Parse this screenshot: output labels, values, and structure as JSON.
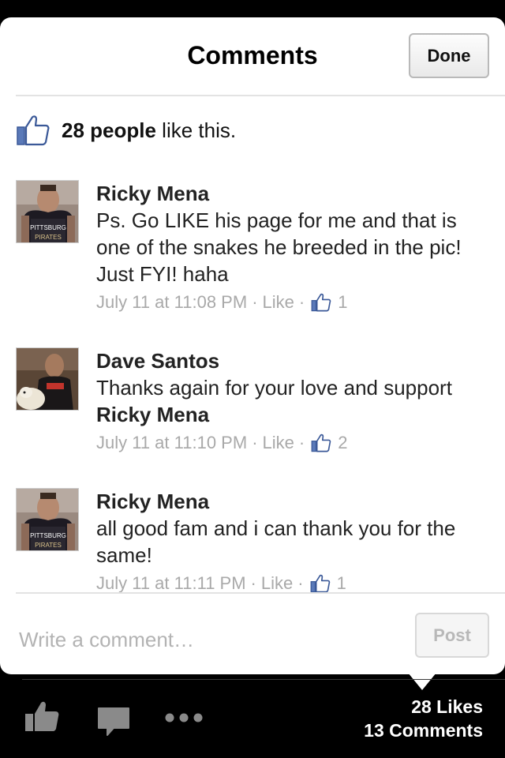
{
  "header": {
    "title": "Comments",
    "done_label": "Done"
  },
  "likes": {
    "count_text": "28 people",
    "suffix": " like this."
  },
  "comments": [
    {
      "author": "Ricky Mena",
      "text": "Ps. Go LIKE his page for me and that is one of the snakes he breeded in the pic! Just FYI! haha",
      "mention": "",
      "time": "July 11 at 11:08 PM",
      "like_label": "Like",
      "like_count": "1"
    },
    {
      "author": "Dave Santos",
      "text": "Thanks again for your love and support",
      "mention": "Ricky Mena",
      "time": "July 11 at 11:10 PM",
      "like_label": "Like",
      "like_count": "2"
    },
    {
      "author": "Ricky Mena",
      "text": "all good fam and i can thank you for the same!",
      "mention": "",
      "time": "July 11 at 11:11 PM",
      "like_label": "Like",
      "like_count": "1"
    }
  ],
  "composer": {
    "placeholder": "Write a comment…",
    "post_label": "Post"
  },
  "footer": {
    "likes_text": "28 Likes",
    "comments_text": "13 Comments"
  },
  "icons": {
    "like": "thumbs-up-icon",
    "comment": "speech-bubble-icon",
    "more": "more-dots-icon"
  },
  "colors": {
    "fb_blue": "#4c6aa8",
    "meta_gray": "#a9a9a9",
    "bar_bg": "#000000"
  }
}
